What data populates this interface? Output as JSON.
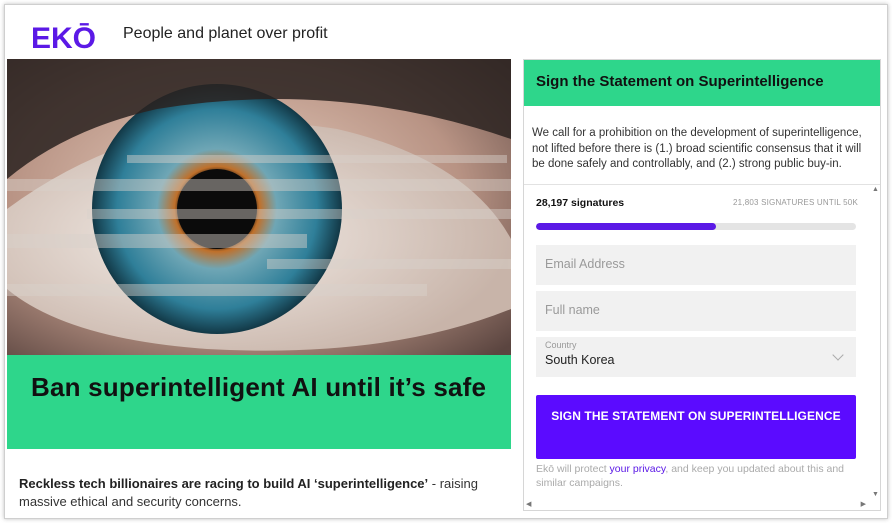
{
  "brand": {
    "logo_text": "EKŌ",
    "tagline": "People and planet over profit",
    "accent": "#5b19e6"
  },
  "hero": {
    "title": "Ban superintelligent AI until it’s safe",
    "band_color": "#2ed68b"
  },
  "intro": {
    "bold": "Reckless tech billionaires are racing to build AI ‘superintelligence’",
    "rest": " - raising massive ethical and security concerns."
  },
  "petition": {
    "heading": "Sign the Statement on Superintelligence",
    "description": "We call for a prohibition on the development of superintelligence, not lifted before there is (1.) broad scientific consensus that it will be done safely and controllably, and (2.) strong public buy-in.",
    "signatures": "28,197 signatures",
    "until_goal": "21,803 SIGNATURES UNTIL 50K",
    "progress_fraction": 0.564,
    "email_placeholder": "Email Address",
    "name_placeholder": "Full name",
    "country_label": "Country",
    "country_value": "South Korea",
    "submit_label": "SIGN THE STATEMENT ON SUPERINTELLIGENCE",
    "privacy_pre": "Ekō will protect ",
    "privacy_link": "your privacy",
    "privacy_post": ", and keep you updated about this and similar campaigns.",
    "button_color": "#5b0bff"
  },
  "icons": {
    "dropdown": "chevron-down-icon",
    "scroll_up": "scroll-up-icon",
    "scroll_down": "scroll-down-icon",
    "scroll_left": "scroll-left-icon",
    "scroll_right": "scroll-right-icon"
  }
}
